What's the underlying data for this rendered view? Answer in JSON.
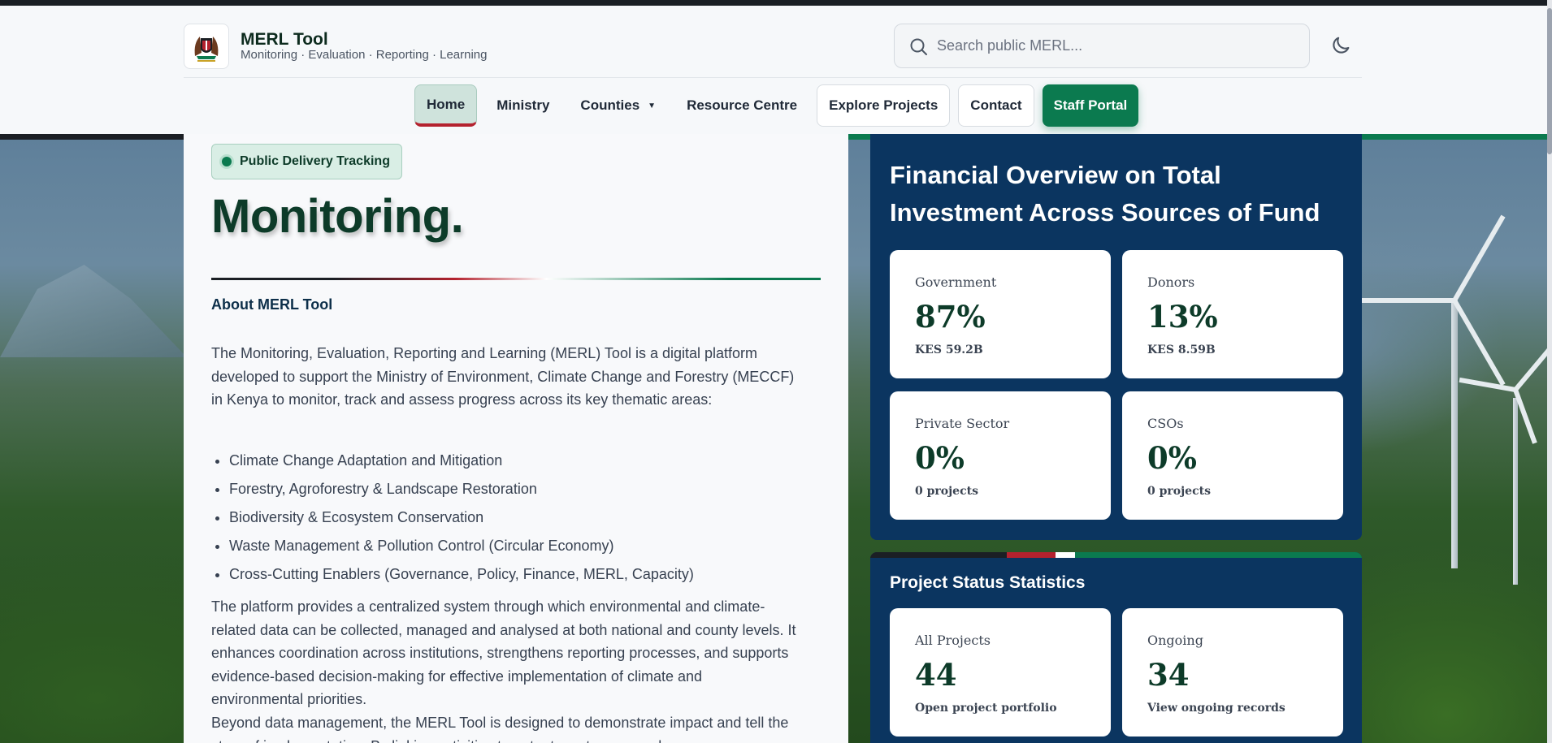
{
  "brand": {
    "title": "MERL Tool",
    "subtitle": "Monitoring · Evaluation · Reporting · Learning"
  },
  "search": {
    "placeholder": "Search public MERL..."
  },
  "icons": {
    "logo": "coat-of-arms-icon",
    "search": "search-icon",
    "theme": "moon-icon",
    "caret": "chevron-down-icon"
  },
  "nav": {
    "home": "Home",
    "ministry": "Ministry",
    "counties": "Counties",
    "resource_centre": "Resource Centre",
    "explore_projects": "Explore Projects",
    "contact": "Contact",
    "staff_portal": "Staff Portal"
  },
  "hero": {
    "badge": "Public Delivery Tracking",
    "title": "Monitoring."
  },
  "about": {
    "title": "About MERL Tool",
    "p1": "The Monitoring, Evaluation, Reporting and Learning (MERL) Tool is a digital platform developed to support the Ministry of Environment, Climate Change and Forestry (MECCF) in Kenya to monitor, track and assess progress across its key thematic areas:",
    "bullets": [
      "Climate Change Adaptation and Mitigation",
      "Forestry, Agroforestry & Landscape Restoration",
      "Biodiversity & Ecosystem Conservation",
      "Waste Management & Pollution Control (Circular Economy)",
      "Cross-Cutting Enablers (Governance, Policy, Finance, MERL, Capacity)"
    ],
    "p2": "The platform provides a centralized system through which environmental and climate-related data can be collected, managed and analysed at both national and county levels. It enhances coordination across institutions, strengthens reporting processes, and supports evidence-based decision-making for effective implementation of climate and environmental priorities.",
    "p3": "Beyond data management, the MERL Tool is designed to demonstrate impact and tell the story of implementation. By linking activities to outputs, outcomes and"
  },
  "financial": {
    "title": "Financial Overview on Total Investment Across Sources of Fund",
    "cards": [
      {
        "label": "Government",
        "value": "87%",
        "sub": "KES 59.2B"
      },
      {
        "label": "Donors",
        "value": "13%",
        "sub": "KES 8.59B"
      },
      {
        "label": "Private Sector",
        "value": "0%",
        "sub": "0 projects"
      },
      {
        "label": "CSOs",
        "value": "0%",
        "sub": "0 projects"
      }
    ]
  },
  "status": {
    "title": "Project Status Statistics",
    "cards": [
      {
        "label": "All Projects",
        "value": "44",
        "sub": "Open project portfolio"
      },
      {
        "label": "Ongoing",
        "value": "34",
        "sub": "View ongoing records"
      }
    ]
  },
  "colors": {
    "brand_green": "#0b7a4f",
    "kenya_red": "#b4222e",
    "kenya_black": "#1b1f24",
    "panel_navy": "#0b3560",
    "heading_green": "#0d3b29"
  }
}
